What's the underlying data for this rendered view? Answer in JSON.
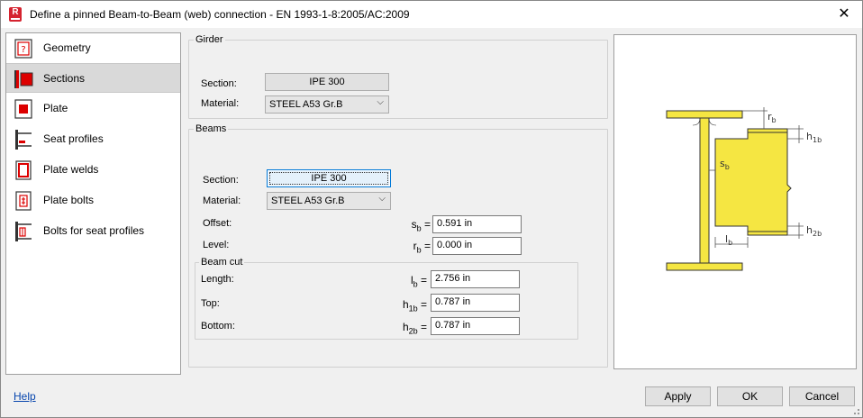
{
  "window": {
    "title": "Define a pinned Beam-to-Beam (web) connection - EN 1993-1-8:2005/AC:2009",
    "app_icon": "R"
  },
  "nav": {
    "items": [
      {
        "label": "Geometry",
        "icon": "geometry-icon"
      },
      {
        "label": "Sections",
        "icon": "sections-icon",
        "active": true
      },
      {
        "label": "Plate",
        "icon": "plate-icon"
      },
      {
        "label": "Seat profiles",
        "icon": "seat-profiles-icon"
      },
      {
        "label": "Plate welds",
        "icon": "plate-welds-icon"
      },
      {
        "label": "Plate bolts",
        "icon": "plate-bolts-icon"
      },
      {
        "label": "Bolts for seat profiles",
        "icon": "bolts-seat-icon"
      }
    ]
  },
  "girder": {
    "group_title": "Girder",
    "section_label": "Section:",
    "section_value": "IPE 300",
    "material_label": "Material:",
    "material_value": "STEEL A53 Gr.B"
  },
  "beams": {
    "group_title": "Beams",
    "section_label": "Section:",
    "section_value": "IPE 300",
    "material_label": "Material:",
    "material_value": "STEEL A53 Gr.B",
    "offset_label": "Offset:",
    "offset_sym": "s",
    "offset_sub": "b",
    "offset_value": "0.591 in",
    "level_label": "Level:",
    "level_sym": "r",
    "level_sub": "b",
    "level_value": "0.000 in"
  },
  "beam_cut": {
    "group_title": "Beam cut",
    "length_label": "Length:",
    "length_sym": "l",
    "length_sub": "b",
    "length_value": "2.756 in",
    "top_label": "Top:",
    "top_sym": "h",
    "top_sub": "1b",
    "top_value": "0.787 in",
    "bottom_label": "Bottom:",
    "bottom_sym": "h",
    "bottom_sub": "2b",
    "bottom_value": "0.787 in"
  },
  "preview": {
    "labels": {
      "rb": "r",
      "rb_sub": "b",
      "h1b": "h",
      "h1b_sub": "1b",
      "sb": "s",
      "sb_sub": "b",
      "h2b": "h",
      "h2b_sub": "2b",
      "lb": "l",
      "lb_sub": "b"
    },
    "colors": {
      "steel": "#f5e642",
      "outline": "#333333",
      "dim": "#555555"
    }
  },
  "footer": {
    "help": "Help",
    "apply": "Apply",
    "ok": "OK",
    "cancel": "Cancel"
  },
  "colors": {
    "accent": "#0078d7",
    "app_icon_bg": "#d5232f",
    "link": "#0645ad"
  }
}
